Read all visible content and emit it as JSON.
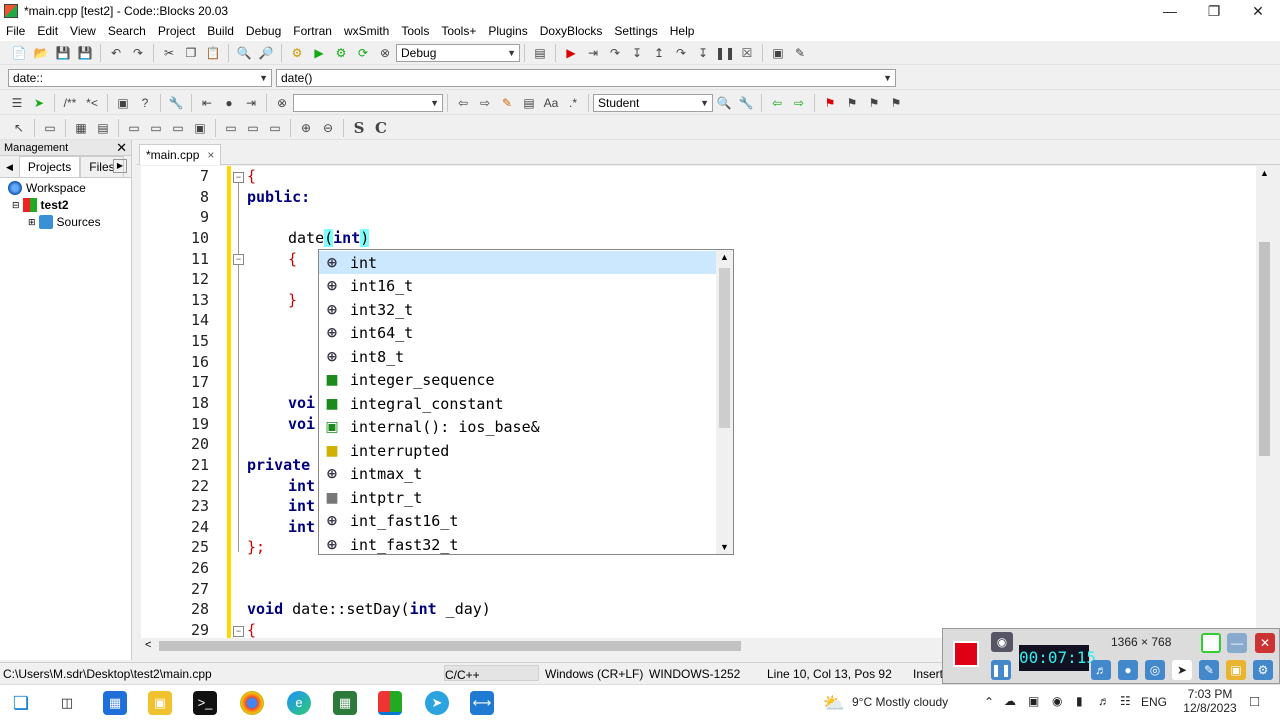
{
  "window": {
    "title": "*main.cpp [test2] - Code::Blocks 20.03"
  },
  "menu": [
    "File",
    "Edit",
    "View",
    "Search",
    "Project",
    "Build",
    "Debug",
    "Fortran",
    "wxSmith",
    "Tools",
    "Tools+",
    "Plugins",
    "DoxyBlocks",
    "Settings",
    "Help"
  ],
  "toolbar": {
    "build_target": "Debug",
    "search_combo": "",
    "class_combo": "Student"
  },
  "code_nav": {
    "scope": "date::",
    "function": "date()"
  },
  "management": {
    "title": "Management",
    "tabs": [
      "Projects",
      "Files"
    ],
    "tree": [
      "Workspace",
      "test2",
      "Sources"
    ]
  },
  "editor_tab": {
    "label": "*main.cpp",
    "close": "×"
  },
  "line_numbers": [
    "7",
    "8",
    "9",
    "10",
    "11",
    "12",
    "13",
    "14",
    "15",
    "16",
    "17",
    "18",
    "19",
    "20",
    "21",
    "22",
    "23",
    "24",
    "25",
    "26",
    "27",
    "28",
    "29"
  ],
  "code": {
    "l7": "{",
    "l8": "public:",
    "l10_a": "date",
    "l10_b": "(",
    "l10_c": "int",
    "l10_d": ")",
    "l11": "{",
    "l13": "}",
    "l18": "voi",
    "l19": "voi",
    "l21": "private",
    "l22": "int",
    "l23": "int",
    "l24": "int",
    "l25": "};",
    "l28_kw": "void",
    "l28_rest": " date::setDay(",
    "l28_kw2": "int",
    "l28_end": " _day)",
    "l29": "{"
  },
  "autocomplete": [
    {
      "icon": "class-icon",
      "label": "int"
    },
    {
      "icon": "class-icon",
      "label": "int16_t"
    },
    {
      "icon": "class-icon",
      "label": "int32_t"
    },
    {
      "icon": "class-icon",
      "label": "int64_t"
    },
    {
      "icon": "class-icon",
      "label": "int8_t"
    },
    {
      "icon": "struct-icon",
      "label": "integer_sequence"
    },
    {
      "icon": "struct-icon",
      "label": "integral_constant"
    },
    {
      "icon": "method-icon",
      "label": "internal(): ios_base&"
    },
    {
      "icon": "enum-value-icon",
      "label": "interrupted"
    },
    {
      "icon": "class-icon",
      "label": "intmax_t"
    },
    {
      "icon": "typedef-icon",
      "label": "intptr_t"
    },
    {
      "icon": "class-icon",
      "label": "int_fast16_t"
    },
    {
      "icon": "class-icon",
      "label": "int_fast32_t"
    }
  ],
  "status": {
    "path": "C:\\Users\\M.sdr\\Desktop\\test2\\main.cpp",
    "lang": "C/C++",
    "eol": "Windows (CR+LF)",
    "encoding": "WINDOWS-1252",
    "position": "Line 10, Col 13, Pos 92",
    "mode": "Insert"
  },
  "recorder": {
    "resolution": "1366 × 768",
    "timer": "00:07:15"
  },
  "taskbar": {
    "weather": "9°C  Mostly cloudy",
    "lang": "ENG",
    "time": "7:03 PM",
    "date": "12/8/2023"
  },
  "colors": {
    "keyword": "#00007f",
    "brace": "#cc0000",
    "brace_match": "#80ffff",
    "popup_selection": "#cce8ff",
    "change_bar": "#ffd800"
  }
}
